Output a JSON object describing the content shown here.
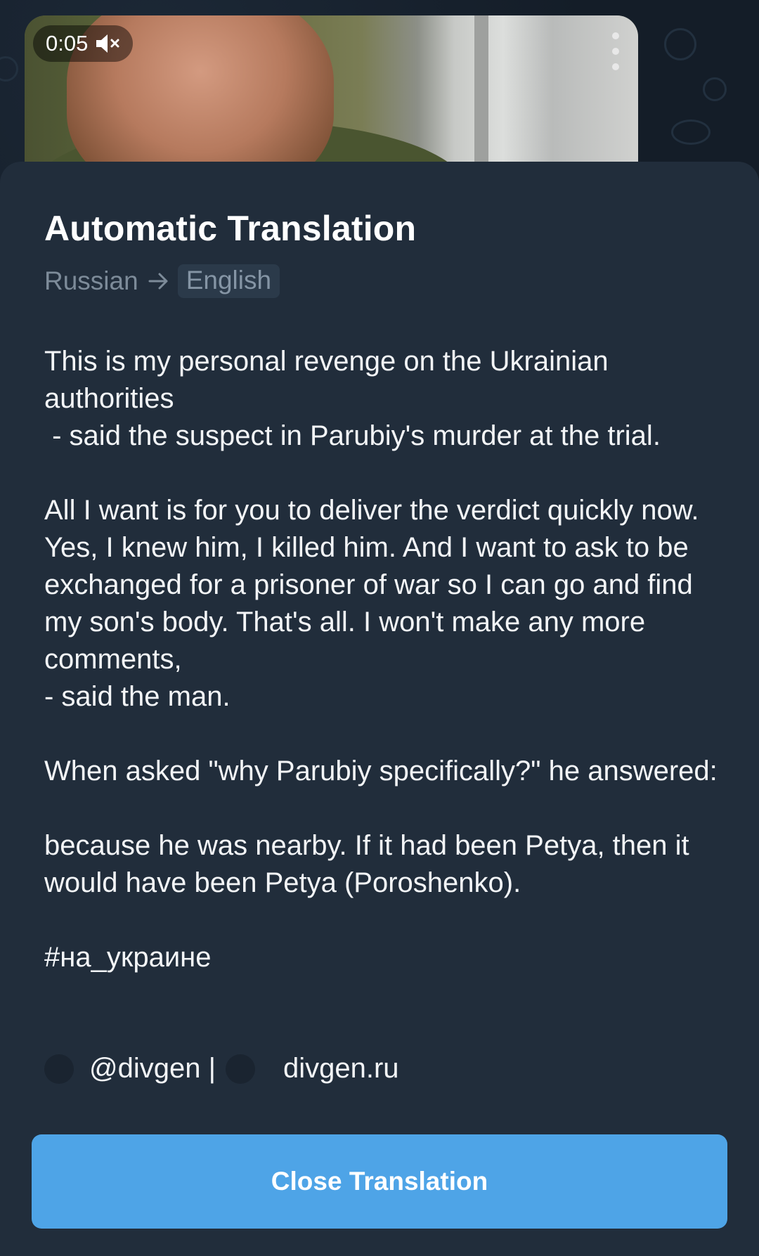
{
  "video": {
    "duration": "0:05",
    "muted": true
  },
  "sheet": {
    "title": "Automatic Translation",
    "source_language": "Russian",
    "target_language": "English",
    "translation_text": "This is my personal revenge on the Ukrainian authorities\n - said the suspect in Parubiy's murder at the trial.\n\nAll I want is for you to deliver the verdict quickly now. Yes, I knew him, I killed him. And I want to ask to be exchanged for a prisoner of war so I can go and find my son's body. That's all. I won't make any more comments,\n- said the man.\n\nWhen asked \"why Parubiy specifically?\" he answered:\n\nbecause he was nearby. If it had been Petya, then it would have been Petya (Poroshenko).\n\n#на_украине",
    "signature_handle": "@divgen |",
    "signature_site": "divgen.ru",
    "close_button_label": "Close Translation"
  },
  "colors": {
    "sheet_background": "#212d3b",
    "button_accent": "#4ea4e7",
    "muted_text": "#7d8b99"
  }
}
